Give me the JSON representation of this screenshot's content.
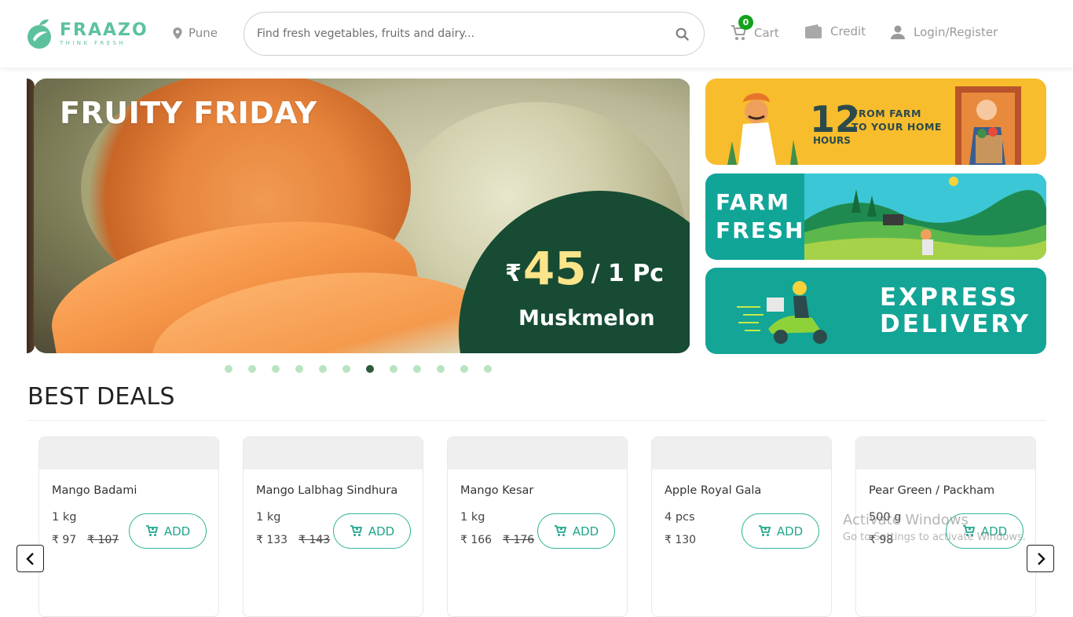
{
  "brand": {
    "name": "FRAAZO",
    "tagline": "THINK FRESH",
    "accent": "#5cc29e"
  },
  "header": {
    "location": "Pune",
    "search_placeholder": "Find fresh vegetables, fruits and dairy...",
    "cart_label": "Cart",
    "cart_count": "0",
    "credit_label": "Credit",
    "login_label": "Login/Register"
  },
  "hero": {
    "title": "FRUITY FRIDAY",
    "currency": "₹",
    "price": "45",
    "unit": "/ 1 Pc",
    "product": "Muskmelon",
    "slide_count": 12,
    "active_slide": 7
  },
  "side_banners": {
    "farm_to_home": {
      "number": "12",
      "line1": "FROM FARM",
      "line2": "TO YOUR HOME",
      "unit": "HOURS"
    },
    "farm_fresh": {
      "line1": "FARM",
      "line2": "FRESH"
    },
    "express": {
      "line1": "EXPRESS",
      "line2": "DELIVERY"
    }
  },
  "deals": {
    "title": "BEST DEALS",
    "add_label": "ADD",
    "items": [
      {
        "name": "Mango Badami",
        "qty": "1 kg",
        "price": "₹ 97",
        "old_price": "₹ 107"
      },
      {
        "name": "Mango Lalbhag Sindhura",
        "qty": "1 kg",
        "price": "₹ 133",
        "old_price": "₹ 143"
      },
      {
        "name": "Mango Kesar",
        "qty": "1 kg",
        "price": "₹ 166",
        "old_price": "₹ 176"
      },
      {
        "name": "Apple Royal Gala",
        "qty": "4 pcs",
        "price": "₹ 130",
        "old_price": ""
      },
      {
        "name": "Pear Green / Packham",
        "qty": "500 g",
        "price": "₹ 98",
        "old_price": ""
      }
    ]
  },
  "watermark": {
    "line1": "Activate Windows",
    "line2": "Go to Settings to activate Windows."
  }
}
